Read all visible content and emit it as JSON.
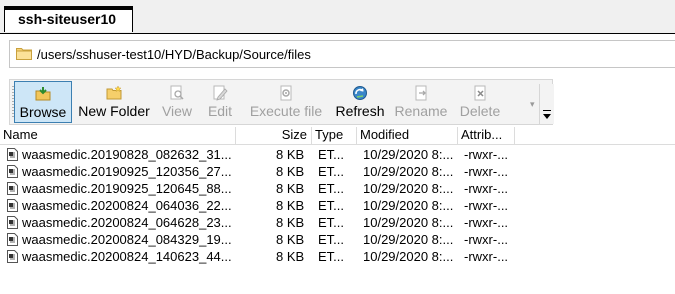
{
  "tab": {
    "title": "ssh-siteuser10"
  },
  "path": {
    "text": "/users/sshuser-test10/HYD/Backup/Source/files"
  },
  "toolbar": {
    "browse": "Browse",
    "new_folder": "New Folder",
    "view": "View",
    "edit": "Edit",
    "execute_file": "Execute file",
    "refresh": "Refresh",
    "rename": "Rename",
    "delete": "Delete"
  },
  "columns": {
    "name": "Name",
    "size": "Size",
    "type": "Type",
    "modified": "Modified",
    "attributes": "Attrib..."
  },
  "files": [
    {
      "name": "waasmedic.20190828_082632_31...",
      "size": "8 KB",
      "type": "ET...",
      "modified": "10/29/2020 8:...",
      "attrib": "-rwxr-..."
    },
    {
      "name": "waasmedic.20190925_120356_27...",
      "size": "8 KB",
      "type": "ET...",
      "modified": "10/29/2020 8:...",
      "attrib": "-rwxr-..."
    },
    {
      "name": "waasmedic.20190925_120645_88...",
      "size": "8 KB",
      "type": "ET...",
      "modified": "10/29/2020 8:...",
      "attrib": "-rwxr-..."
    },
    {
      "name": "waasmedic.20200824_064036_22...",
      "size": "8 KB",
      "type": "ET...",
      "modified": "10/29/2020 8:...",
      "attrib": "-rwxr-..."
    },
    {
      "name": "waasmedic.20200824_064628_23...",
      "size": "8 KB",
      "type": "ET...",
      "modified": "10/29/2020 8:...",
      "attrib": "-rwxr-..."
    },
    {
      "name": "waasmedic.20200824_084329_19...",
      "size": "8 KB",
      "type": "ET...",
      "modified": "10/29/2020 8:...",
      "attrib": "-rwxr-..."
    },
    {
      "name": "waasmedic.20200824_140623_44...",
      "size": "8 KB",
      "type": "ET...",
      "modified": "10/29/2020 8:...",
      "attrib": "-rwxr-..."
    }
  ]
}
